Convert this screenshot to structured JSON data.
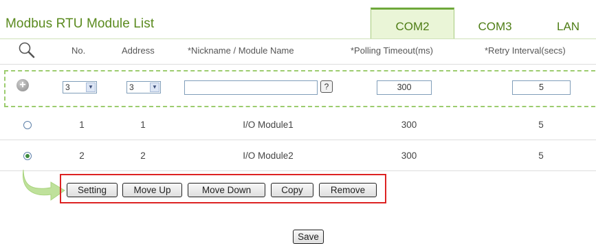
{
  "page": {
    "title": "Modbus RTU Module List",
    "tabs": [
      {
        "label": "COM2",
        "active": true
      },
      {
        "label": "COM3",
        "active": false
      },
      {
        "label": "LAN",
        "active": false
      }
    ]
  },
  "table": {
    "headers": {
      "no": "No.",
      "address": "Address",
      "nickname": "*Nickname / Module Name",
      "timeout": "*Polling Timeout(ms)",
      "retry": "*Retry Interval(secs)"
    },
    "add_row": {
      "no_value": "3",
      "address_value": "3",
      "nickname_value": "",
      "help_label": "?",
      "timeout_value": "300",
      "retry_value": "5"
    },
    "rows": [
      {
        "no": "1",
        "address": "1",
        "name": "I/O Module1",
        "timeout": "300",
        "retry": "5",
        "selected": false
      },
      {
        "no": "2",
        "address": "2",
        "name": "I/O Module2",
        "timeout": "300",
        "retry": "5",
        "selected": true
      }
    ]
  },
  "actions": {
    "setting": "Setting",
    "move_up": "Move Up",
    "move_down": "Move Down",
    "copy": "Copy",
    "remove": "Remove"
  },
  "footer": {
    "save": "Save"
  },
  "colors": {
    "accent_green": "#5a8a1e",
    "tab_active_bg": "#eaf5d7",
    "highlight_red": "#dd2222"
  },
  "icons": {
    "search": "search-icon",
    "add": "plus-circle-icon",
    "dropdown": "chevron-down-icon",
    "flow_arrow": "curved-arrow-icon"
  }
}
